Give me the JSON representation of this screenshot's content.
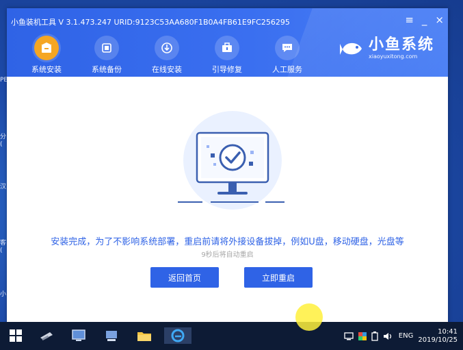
{
  "desktop": {
    "snippets": [
      "PE",
      "分\n(",
      "汉",
      "客\n(",
      "小"
    ]
  },
  "window": {
    "title": "小鱼装机工具 V 3.1.473.247 URID:9123C53AA680F1B0A4FB61E9FC256295",
    "controls": {
      "menu": "≡",
      "minimize": "_",
      "close": "×"
    }
  },
  "nav": {
    "items": [
      {
        "label": "系统安装",
        "icon": "system-install-icon",
        "active": true
      },
      {
        "label": "系统备份",
        "icon": "system-backup-icon"
      },
      {
        "label": "在线安装",
        "icon": "online-install-icon"
      },
      {
        "label": "引导修复",
        "icon": "boot-repair-icon"
      },
      {
        "label": "人工服务",
        "icon": "support-chat-icon"
      }
    ]
  },
  "logo": {
    "main": "小鱼系统",
    "sub": "xiaoyuxitong.com"
  },
  "content": {
    "message": "安装完成，为了不影响系统部署，重启前请将外接设备拔掉，例如U盘，移动硬盘，光盘等",
    "countdown": "9秒后将自动重启",
    "buttons": {
      "home": "返回首页",
      "restart": "立即重启"
    }
  },
  "taskbar": {
    "apps": [
      "start-icon",
      "tool-icon",
      "computer-icon",
      "network-icon",
      "folder-icon",
      "browser-icon"
    ],
    "tray": {
      "lang": "ENG",
      "time": "10:41",
      "date": "2019/10/25"
    }
  },
  "colors": {
    "accent": "#2f63e6",
    "nav_active": "#f5a623",
    "taskbar": "#0d1b35"
  }
}
